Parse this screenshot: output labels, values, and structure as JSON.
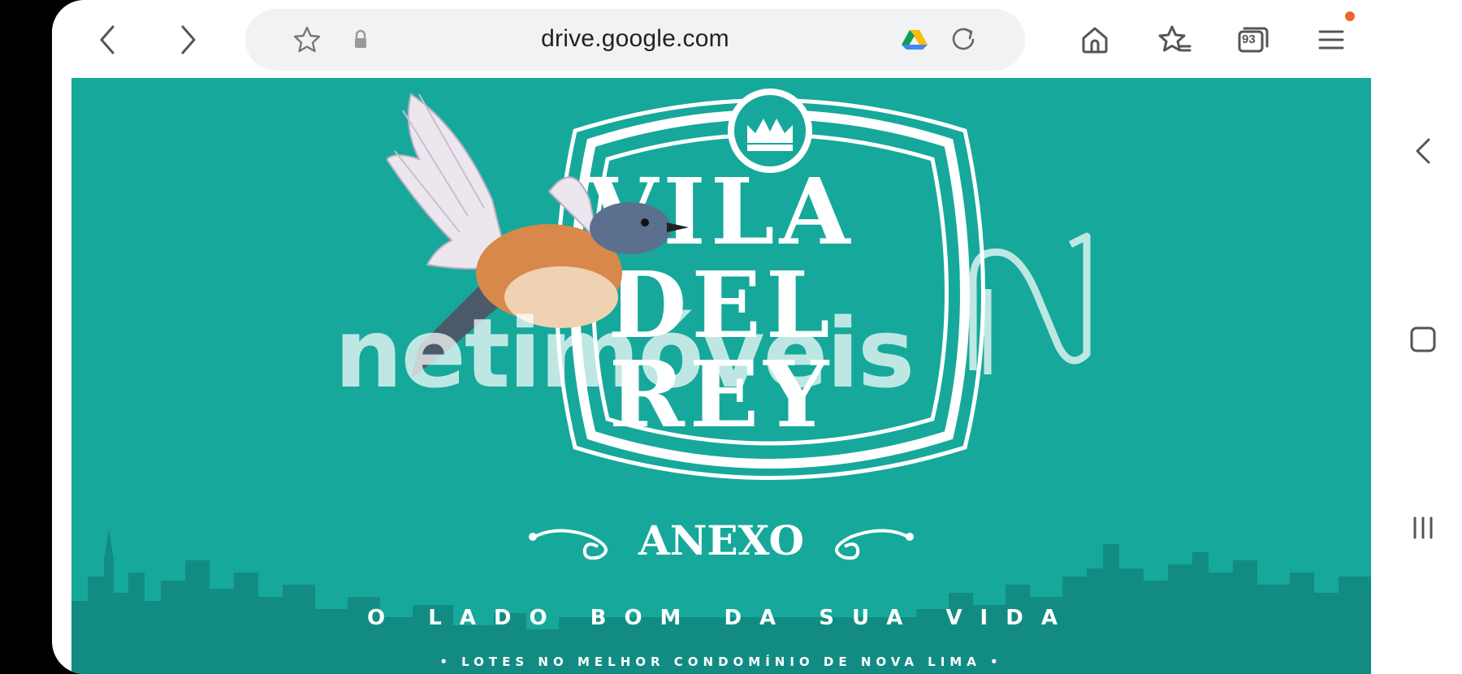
{
  "browser": {
    "url": "drive.google.com",
    "tab_count": "93"
  },
  "page": {
    "brand_line1": "VILA",
    "brand_line2": "DEL",
    "brand_line3": "REY",
    "anexo": "ANEXO",
    "tagline": "O LADO BOM DA SUA VIDA",
    "subline": "• LOTES NO MELHOR CONDOMÍNIO DE NOVA LIMA •",
    "watermark": "netimóveis"
  },
  "colors": {
    "background": "#16a89b",
    "chrome": "#ffffff",
    "notification_dot": "#e8672d"
  },
  "icons": {
    "back": "chevron-left-icon",
    "forward": "chevron-right-icon",
    "bookmark": "star-outline-icon",
    "secure": "lock-icon",
    "drive": "google-drive-icon",
    "reload": "reload-icon",
    "home": "home-icon",
    "favorites": "star-list-icon",
    "tabs": "tabs-counter-icon",
    "menu": "hamburger-menu-icon",
    "system_back": "chevron-left-icon",
    "system_home": "square-home-icon",
    "system_recents": "recents-icon"
  }
}
